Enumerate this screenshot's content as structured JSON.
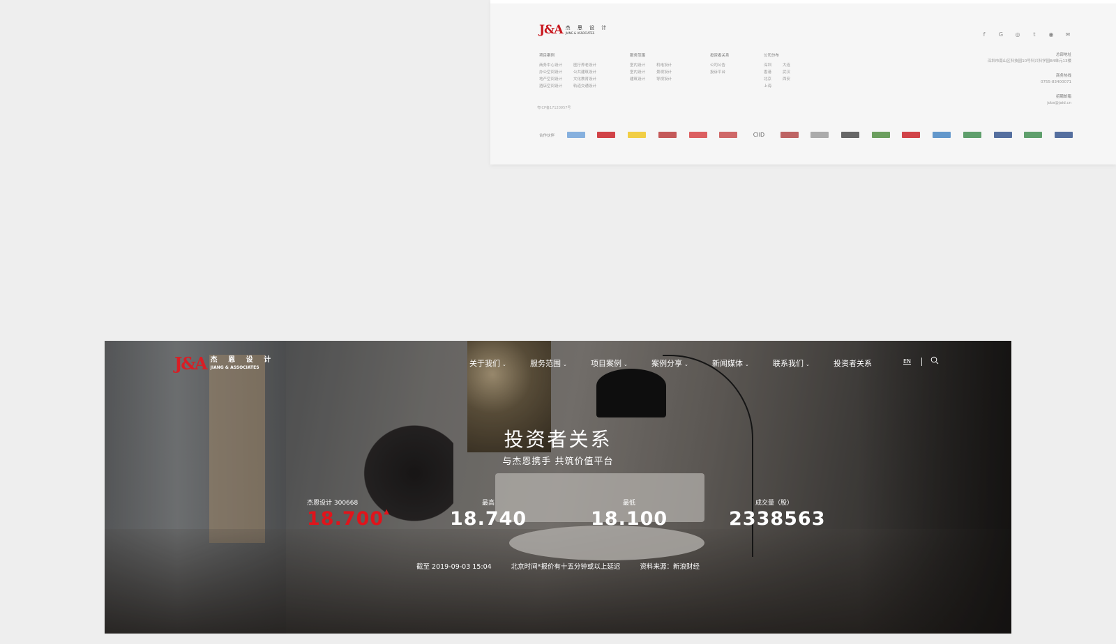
{
  "footer": {
    "logo": {
      "mark": "J&A",
      "cn": "杰 恩 设 计",
      "en": "JIANG & ASSOCIATES"
    },
    "social_icons": [
      "facebook-icon",
      "google-icon",
      "instagram-icon",
      "twitter-icon",
      "weibo-icon",
      "wechat-icon"
    ],
    "social_glyphs": [
      "f",
      "G",
      "◎",
      "t",
      "◉",
      "✉"
    ],
    "columns": [
      {
        "heading": "项目案例",
        "rows": [
          [
            "商务中心设计",
            "医疗养老设计"
          ],
          [
            "办公空间设计",
            "公共建筑设计"
          ],
          [
            "地产空间设计",
            "文化教育设计"
          ],
          [
            "酒店空间设计",
            "轨道交通设计"
          ]
        ]
      },
      {
        "heading": "服务范围",
        "rows": [
          [
            "室内设计",
            "机电设计"
          ],
          [
            "室内设计",
            "景观设计"
          ],
          [
            "建筑设计",
            "导视设计"
          ]
        ]
      },
      {
        "heading": "投资者关系",
        "rows": [
          [
            "公司公告"
          ],
          [
            "投诉平台"
          ]
        ]
      },
      {
        "heading": "公司分布",
        "rows": [
          [
            "深圳",
            "大连"
          ],
          [
            "香港",
            "武汉"
          ],
          [
            "北京",
            "西安"
          ],
          [
            "上海"
          ]
        ]
      }
    ],
    "contact": [
      {
        "heading": "总部地址",
        "value": "深圳市南山区科技园10号科兴科学园B4单元13楼"
      },
      {
        "heading": "商务热线",
        "value": "0755-83400071"
      },
      {
        "heading": "招聘邮箱",
        "value": "jobs@jaid.cn"
      }
    ],
    "icp": "粤ICP备17120957号",
    "partners_label": "合作伙伴",
    "partner_colors": [
      "#6a9fd8",
      "#c8161d",
      "#f0c419",
      "#b83232",
      "#d6393c",
      "#c54545",
      "#666666",
      "#b04040",
      "#999999",
      "#444444",
      "#4a8a3a",
      "#c8161d",
      "#3d7fc0",
      "#3a8a4a",
      "#2d4d8a",
      "#3a8a4a",
      "#2d4d8a"
    ],
    "partner_text": {
      "ciid": "CIID"
    }
  },
  "hero": {
    "logo": {
      "mark": "J&A",
      "cn": "杰 恩 设 计",
      "en": "JIANG & ASSOCIATES"
    },
    "nav": [
      {
        "label": "关于我们",
        "has_dropdown": true
      },
      {
        "label": "服务范围",
        "has_dropdown": true
      },
      {
        "label": "项目案例",
        "has_dropdown": true
      },
      {
        "label": "案例分享",
        "has_dropdown": true
      },
      {
        "label": "新闻媒体",
        "has_dropdown": true
      },
      {
        "label": "联系我们",
        "has_dropdown": true
      },
      {
        "label": "投资者关系",
        "has_dropdown": false
      }
    ],
    "lang": "EN",
    "title": "投资者关系",
    "subtitle": "与杰恩携手 共筑价值平台",
    "stats": [
      {
        "label": "杰恩设计 300668",
        "value": "18.700",
        "trend": "▲",
        "color": "#e0141b"
      },
      {
        "label": "最高",
        "value": "18.740"
      },
      {
        "label": "最低",
        "value": "18.100"
      },
      {
        "label": "成交量（股）",
        "value": "2338563"
      }
    ],
    "footnotes": [
      "截至 2019-09-03 15:04",
      "北京时间*报价有十五分钟或以上延迟",
      "资料来源：新浪财经"
    ]
  }
}
